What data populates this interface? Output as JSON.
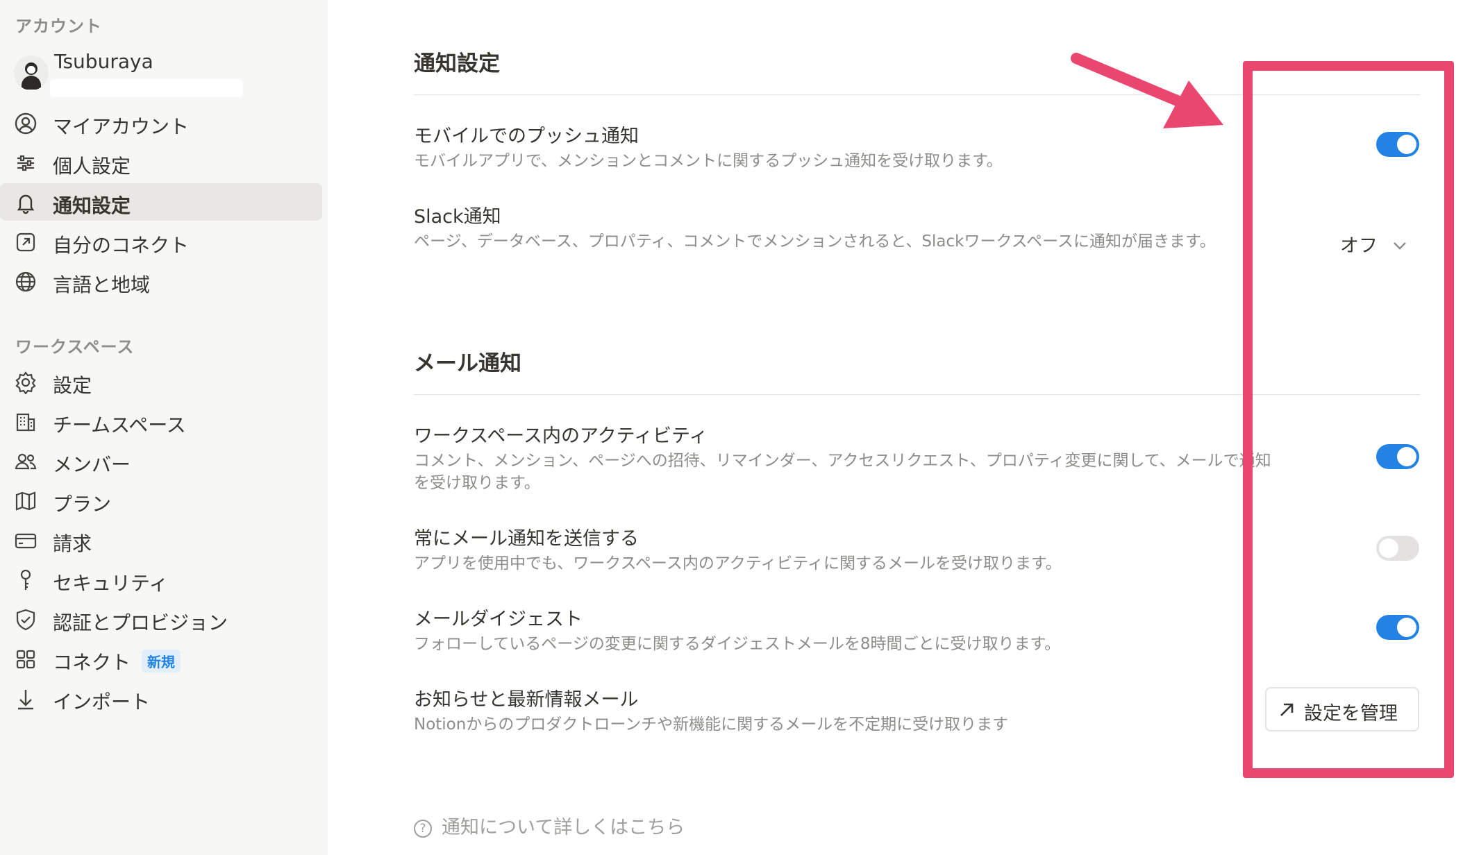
{
  "sidebar": {
    "account_heading": "アカウント",
    "account_name": "Tsuburaya",
    "account_items": [
      {
        "label": "マイアカウント",
        "icon": "user-circle-icon"
      },
      {
        "label": "個人設定",
        "icon": "sliders-icon"
      },
      {
        "label": "通知設定",
        "icon": "bell-icon",
        "active": true
      },
      {
        "label": "自分のコネクト",
        "icon": "external-link-box-icon"
      },
      {
        "label": "言語と地域",
        "icon": "globe-icon"
      }
    ],
    "workspace_heading": "ワークスペース",
    "workspace_items": [
      {
        "label": "設定",
        "icon": "gear-icon"
      },
      {
        "label": "チームスペース",
        "icon": "building-icon"
      },
      {
        "label": "メンバー",
        "icon": "users-icon"
      },
      {
        "label": "プラン",
        "icon": "map-icon"
      },
      {
        "label": "請求",
        "icon": "credit-card-icon"
      },
      {
        "label": "セキュリティ",
        "icon": "key-icon"
      },
      {
        "label": "認証とプロビジョン",
        "icon": "shield-check-icon"
      },
      {
        "label": "コネクト",
        "icon": "grid-icon",
        "badge": "新規"
      },
      {
        "label": "インポート",
        "icon": "download-icon"
      }
    ]
  },
  "main": {
    "notifications_title": "通知設定",
    "mobile_push": {
      "title": "モバイルでのプッシュ通知",
      "desc": "モバイルアプリで、メンションとコメントに関するプッシュ通知を受け取ります。",
      "enabled": true
    },
    "slack": {
      "title": "Slack通知",
      "desc": "ページ、データベース、プロパティ、コメントでメンションされると、Slackワークスペースに通知が届きます。",
      "value": "オフ"
    },
    "email_title": "メール通知",
    "workspace_activity": {
      "title": "ワークスペース内のアクティビティ",
      "desc": "コメント、メンション、ページへの招待、リマインダー、アクセスリクエスト、プロパティ変更に関して、メールで通知を受け取ります。",
      "enabled": true
    },
    "always_email": {
      "title": "常にメール通知を送信する",
      "desc": "アプリを使用中でも、ワークスペース内のアクティビティに関するメールを受け取ります。",
      "enabled": false
    },
    "digest": {
      "title": "メールダイジェスト",
      "desc": "フォローしているページの変更に関するダイジェストメールを8時間ごとに受け取ります。",
      "enabled": true
    },
    "announcements": {
      "title": "お知らせと最新情報メール",
      "desc": "Notionからのプロダクトローンチや新機能に関するメールを不定期に受け取ります",
      "button_label": "設定を管理"
    },
    "help_link": "通知について詳しくはこちら"
  },
  "colors": {
    "accent": "#2383e2",
    "annotation": "#e94670",
    "sidebar_bg": "#f7f7f5"
  }
}
